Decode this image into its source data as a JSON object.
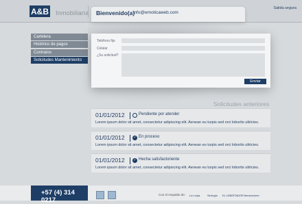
{
  "header": {
    "logo_text": "A&B",
    "brand": "Inmobiliaria",
    "welcome": "Bienvenido(a)",
    "email": "info@emoticaweb.com",
    "exit": "Salida segura"
  },
  "menu": {
    "items": [
      "Cartelera",
      "Histórico de pagos",
      "Contratos",
      "Solicitudes Mantenimiento"
    ]
  },
  "form": {
    "phone_label": "Teléfono fijo",
    "mobile_label": "Celular",
    "request_label": "¿Su solicitud?",
    "send": "Enviar"
  },
  "requests": {
    "title": "Solicitudes anteriores",
    "items": [
      {
        "date": "01/01/2012",
        "status": "Pendiente por atender",
        "desc": "Lorem ipsum dolor sit amet, consectetur adipiscing elit. Aenean eu turpis sed orci lobortis ultricies."
      },
      {
        "date": "01/01/2012",
        "status": "En proceso",
        "desc": "Lorem ipsum dolor sit amet, consectetur adipiscing elit. Aenean eu turpis sed orci lobortis ultricies."
      },
      {
        "date": "01/01/2012",
        "status": "Hecha satisfactoriente",
        "desc": "Lorem ipsum dolor sit amet, consectetur adipiscing elit. Aenean eu turpis sed orci lobortis ultricies."
      }
    ]
  },
  "footer": {
    "phone": "+57 (4) 314 0217",
    "backed": "Con el respaldo de:",
    "sponsors": [
      "La Lonja",
      "Sinergia",
      "EL LIBERTADOR",
      "fiemencione"
    ]
  },
  "colors": {
    "accent": "#1e3e66",
    "menu": "#7f8a95"
  }
}
